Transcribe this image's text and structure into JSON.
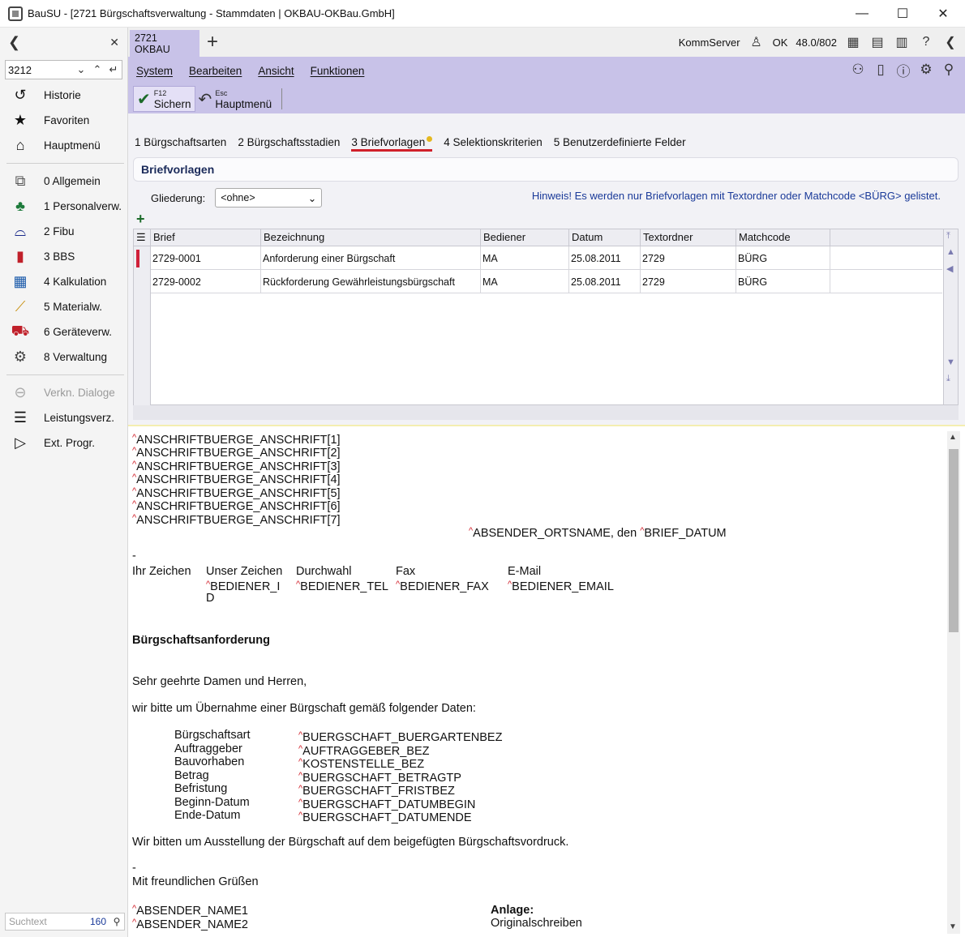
{
  "window": {
    "title": "BauSU - [2721 Bürgschaftsverwaltung - Stammdaten | OKBAU-OKBau.GmbH]",
    "minimize": "—",
    "maximize": "☐",
    "close": "✕"
  },
  "sidebar": {
    "back": "❮",
    "pin": "✕",
    "search_value": "3212",
    "items_top": [
      {
        "label": "Historie",
        "icon": "history-icon"
      },
      {
        "label": "Favoriten",
        "icon": "star-icon"
      },
      {
        "label": "Hauptmenü",
        "icon": "home-icon"
      }
    ],
    "modules": [
      {
        "label": "0 Allgemein",
        "icon": "general-icon"
      },
      {
        "label": "1 Personalverw.",
        "icon": "personnel-icon"
      },
      {
        "label": "2 Fibu",
        "icon": "fibu-icon"
      },
      {
        "label": "3 BBS",
        "icon": "bbs-chart-icon"
      },
      {
        "label": "4 Kalkulation",
        "icon": "calculation-icon"
      },
      {
        "label": "5 Materialw.",
        "icon": "material-icon"
      },
      {
        "label": "6 Geräteverw.",
        "icon": "equipment-icon"
      },
      {
        "label": "8 Verwaltung",
        "icon": "gear-icon"
      }
    ],
    "items_bottom": [
      {
        "label": "Verkn. Dialoge",
        "icon": "link-icon",
        "disabled": true
      },
      {
        "label": "Leistungsverz.",
        "icon": "list-icon",
        "disabled": false
      },
      {
        "label": "Ext. Progr.",
        "icon": "play-icon",
        "disabled": false
      }
    ],
    "search_placeholder": "Suchtext",
    "search_count": "160"
  },
  "tabstrip": {
    "doc_tab_line1": "2721",
    "doc_tab_line2": "OKBAU",
    "add": "+",
    "server": "KommServer",
    "ok": "OK",
    "version": "48.0/802"
  },
  "menu": {
    "items": [
      "System",
      "Bearbeiten",
      "Ansicht",
      "Funktionen"
    ]
  },
  "toolbar": {
    "save_key": "F12",
    "save_label": "Sichern",
    "main_key": "Esc",
    "main_label": "Hauptmenü"
  },
  "tabs": [
    {
      "label": "1 Bürgschaftsarten"
    },
    {
      "label": "2 Bürgschaftsstadien"
    },
    {
      "label": "3 Briefvorlagen",
      "active": true
    },
    {
      "label": "4 Selektionskriterien"
    },
    {
      "label": "5 Benutzerdefinierte Felder"
    }
  ],
  "section": {
    "title": "Briefvorlagen",
    "gliederung_label": "Gliederung:",
    "gliederung_value": "<ohne>",
    "hint": "Hinweis! Es werden nur Briefvorlagen mit Textordner oder Matchcode <BÜRG> gelistet."
  },
  "grid": {
    "columns": [
      "Brief",
      "Bezeichnung",
      "Bediener",
      "Datum",
      "Textordner",
      "Matchcode"
    ],
    "rows": [
      [
        "2729-0001",
        "Anforderung einer Bürgschaft",
        "MA",
        "25.08.2011",
        "2729",
        "BÜRG"
      ],
      [
        "2729-0002",
        "Rückforderung Gewährleistungsbürgschaft",
        "MA",
        "25.08.2011",
        "2729",
        "BÜRG"
      ]
    ]
  },
  "letter": {
    "address": [
      "ANSCHRIFTBUERGE_ANSCHRIFT[1]",
      "ANSCHRIFTBUERGE_ANSCHRIFT[2]",
      "ANSCHRIFTBUERGE_ANSCHRIFT[3]",
      "ANSCHRIFTBUERGE_ANSCHRIFT[4]",
      "ANSCHRIFTBUERGE_ANSCHRIFT[5]",
      "ANSCHRIFTBUERGE_ANSCHRIFT[6]",
      "ANSCHRIFTBUERGE_ANSCHRIFT[7]"
    ],
    "place_a": "ABSENDER_ORTSNAME, den ",
    "place_b": "BRIEF_DATUM",
    "dash1": "-",
    "ref_headers": [
      "Ihr Zeichen",
      "Unser Zeichen",
      "Durchwahl",
      "Fax",
      "E-Mail"
    ],
    "ref_values": [
      "BEDIENER_I",
      "BEDIENER_TEL",
      "BEDIENER_FAX",
      "BEDIENER_EMAIL"
    ],
    "ref_wrap": "D",
    "subject": "Bürgschaftsanforderung",
    "salutation": "Sehr geehrte Damen und Herren,",
    "intro": "wir bitte um Übernahme einer Bürgschaft gemäß folgender Daten:",
    "fields": [
      [
        "Bürgschaftsart",
        "BUERGSCHAFT_BUERGARTENBEZ"
      ],
      [
        "Auftraggeber",
        "AUFTRAGGEBER_BEZ"
      ],
      [
        "Bauvorhaben",
        "KOSTENSTELLE_BEZ"
      ],
      [
        "Betrag",
        "BUERGSCHAFT_BETRAGTP"
      ],
      [
        "Befristung",
        "BUERGSCHAFT_FRISTBEZ"
      ],
      [
        "Beginn-Datum",
        "BUERGSCHAFT_DATUMBEGIN"
      ],
      [
        "Ende-Datum",
        "BUERGSCHAFT_DATUMENDE"
      ]
    ],
    "request": "Wir bitten um Ausstellung der Bürgschaft auf dem beigefügten Bürgschaftsvordruck.",
    "dash2": "-",
    "closing": "Mit freundlichen Grüßen",
    "sender": [
      "ABSENDER_NAME1",
      "ABSENDER_NAME2"
    ],
    "attachment_label": "Anlage:",
    "attachment_value": "Originalschreiben"
  }
}
